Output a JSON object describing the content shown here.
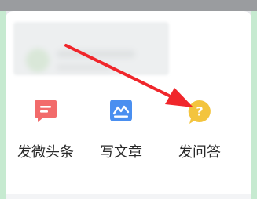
{
  "actions": [
    {
      "label": "发微头条",
      "icon": "micro-headline-icon",
      "color": "#f26b6b"
    },
    {
      "label": "写文章",
      "icon": "write-article-icon",
      "color": "#4a8ff0"
    },
    {
      "label": "发问答",
      "icon": "question-answer-icon",
      "color": "#f3c43e"
    }
  ],
  "question_mark": "?",
  "annotation": {
    "icon": "red-arrow-annotation",
    "color": "#f0262b"
  }
}
